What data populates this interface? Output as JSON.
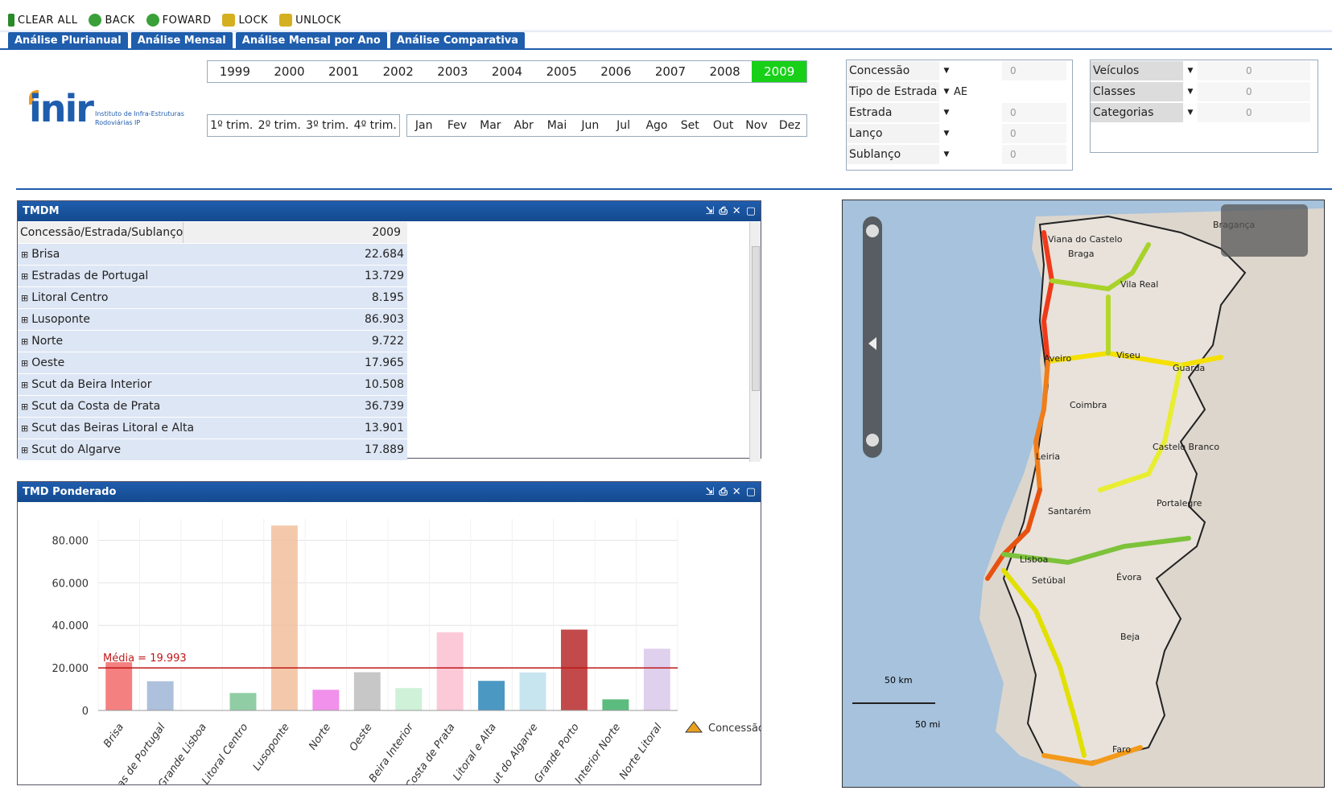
{
  "toolbar": {
    "clear_all": "CLEAR ALL",
    "back": "BACK",
    "forward": "FOWARD",
    "lock": "LOCK",
    "unlock": "UNLOCK"
  },
  "tabs": [
    "Análise Plurianual",
    "Análise Mensal",
    "Análise Mensal por Ano",
    "Análise Comparativa"
  ],
  "years": [
    "1999",
    "2000",
    "2001",
    "2002",
    "2003",
    "2004",
    "2005",
    "2006",
    "2007",
    "2008",
    "2009"
  ],
  "selected_year": "2009",
  "quarters": [
    "1º trim.",
    "2º trim.",
    "3º trim.",
    "4º trim."
  ],
  "months": [
    "Jan",
    "Fev",
    "Mar",
    "Abr",
    "Mai",
    "Jun",
    "Jul",
    "Ago",
    "Set",
    "Out",
    "Nov",
    "Dez"
  ],
  "logo": {
    "name": "inir",
    "sub1": "Instituto de Infra-Estruturas",
    "sub2": "Rodoviárias IP"
  },
  "filters1": [
    {
      "label": "Concessão",
      "value": "",
      "dot": "0"
    },
    {
      "label": "Tipo de Estrada",
      "value": "AE",
      "dot": ""
    },
    {
      "label": "Estrada",
      "value": "",
      "dot": "0"
    },
    {
      "label": "Lanço",
      "value": "",
      "dot": "0"
    },
    {
      "label": "Sublanço",
      "value": "",
      "dot": "0"
    }
  ],
  "filters2": [
    {
      "label": "Veículos",
      "dot": "0"
    },
    {
      "label": "Classes",
      "dot": "0"
    },
    {
      "label": "Categorias",
      "dot": "0"
    }
  ],
  "tmdm": {
    "title": "TMDM",
    "col1": "Concessão/Estrada/Sublanço",
    "col2": "2009",
    "rows": [
      [
        "Brisa",
        "22.684"
      ],
      [
        "Estradas de Portugal",
        "13.729"
      ],
      [
        "Litoral Centro",
        "8.195"
      ],
      [
        "Lusoponte",
        "86.903"
      ],
      [
        "Norte",
        "9.722"
      ],
      [
        "Oeste",
        "17.965"
      ],
      [
        "Scut da Beira Interior",
        "10.508"
      ],
      [
        "Scut da Costa de Prata",
        "36.739"
      ],
      [
        "Scut das Beiras Litoral e Alta",
        "13.901"
      ],
      [
        "Scut do Algarve",
        "17.889"
      ]
    ]
  },
  "chart_panel": {
    "title": "TMD Ponderado",
    "legend_label": "Concessão",
    "mean_label": "Média = 19.993"
  },
  "chart_data": {
    "type": "bar",
    "categories": [
      "Brisa",
      "Estradas de Portugal",
      "Grande Lisboa",
      "Litoral Centro",
      "Lusoponte",
      "Norte",
      "Oeste",
      "Beira Interior",
      "Costa de Prata",
      "Litoral e Alta",
      "do Algarve",
      "Grande Porto",
      "Interior Norte",
      "Norte Litoral"
    ],
    "tick_labels": [
      "Brisa",
      "as de Portugal",
      "Grande Lisboa",
      "Litoral Centro",
      "Lusoponte",
      "Norte",
      "Oeste",
      "Beira Interior",
      "Costa de Prata",
      "Litoral e Alta",
      "ut do Algarve",
      "Grande Porto",
      "Interior Norte",
      "Norte Litoral"
    ],
    "values": [
      22684,
      13729,
      0,
      8195,
      86903,
      9722,
      17965,
      10508,
      36739,
      13901,
      17889,
      38000,
      5200,
      29000
    ],
    "colors": [
      "#f26a6a",
      "#9fb5d6",
      "#cccccc",
      "#7cc494",
      "#f2c09c",
      "#ee7ee8",
      "#bdbdbd",
      "#c6efd0",
      "#fcc0d2",
      "#2b86b8",
      "#bde0ec",
      "#b72a2a",
      "#3fb069",
      "#d9c8ea"
    ],
    "yticks": [
      0,
      20000,
      40000,
      60000,
      80000
    ],
    "ytick_labels": [
      "0",
      "20.000",
      "40.000",
      "60.000",
      "80.000"
    ],
    "ylim": [
      0,
      90000
    ],
    "mean": 19993
  },
  "map": {
    "cities": [
      "Viana do Castelo",
      "Braga",
      "Bragança",
      "Vila Real",
      "Aveiro",
      "Viseu",
      "Guarda",
      "Coimbra",
      "Leiria",
      "Castelo Branco",
      "Santarém",
      "Portalegre",
      "Lisboa",
      "Setúbal",
      "Évora",
      "Beja",
      "Faro"
    ],
    "scale_km": "50 km",
    "scale_mi": "50 mi"
  }
}
